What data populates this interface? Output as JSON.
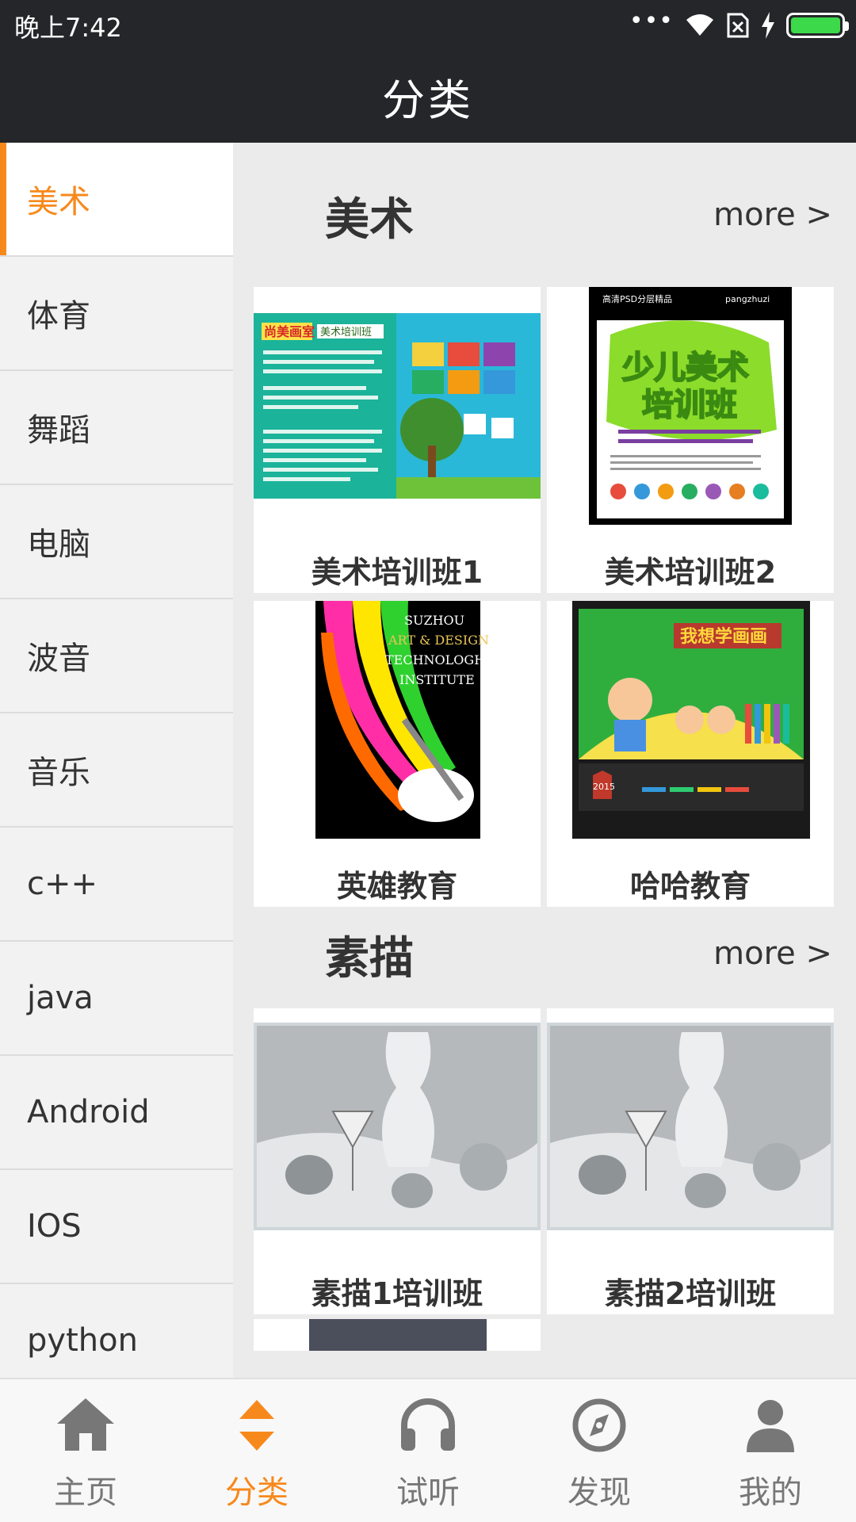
{
  "status_bar": {
    "time": "晚上7:42",
    "dots": "•••"
  },
  "title_bar": {
    "title": "分类"
  },
  "sidebar": {
    "items": [
      {
        "label": "美术"
      },
      {
        "label": "体育"
      },
      {
        "label": "舞蹈"
      },
      {
        "label": "电脑"
      },
      {
        "label": "波音"
      },
      {
        "label": "音乐"
      },
      {
        "label": "c++"
      },
      {
        "label": "java"
      },
      {
        "label": "Android"
      },
      {
        "label": "IOS"
      },
      {
        "label": "python"
      }
    ]
  },
  "sections": [
    {
      "title": "美术",
      "more": "more >",
      "cards": [
        {
          "caption": "美术培训班1"
        },
        {
          "caption": "美术培训班2"
        },
        {
          "caption": "英雄教育"
        },
        {
          "caption": "哈哈教育"
        }
      ]
    },
    {
      "title": "素描",
      "more": "more >",
      "cards": [
        {
          "caption": "素描1培训班"
        },
        {
          "caption": "素描2培训班"
        }
      ]
    }
  ],
  "poster_texts": {
    "p1_badge": "尚美画室",
    "p1_sub": "美术培训班",
    "p2_header_left": "高清PSD分层精品",
    "p2_header_right": "pangzhuzi",
    "p2_title_1": "少儿美术",
    "p2_title_2": "培训班",
    "p3_lines": [
      "SUZHOU",
      "ART & DESIGN",
      "TECHNOLOGHY",
      "INSTITUTE"
    ],
    "p4_title": "我想学画画",
    "p4_badge": "2015"
  },
  "bottom_nav": {
    "items": [
      {
        "label": "主页",
        "icon": "home-icon"
      },
      {
        "label": "分类",
        "icon": "category-icon"
      },
      {
        "label": "试听",
        "icon": "headphones-icon"
      },
      {
        "label": "发现",
        "icon": "compass-icon"
      },
      {
        "label": "我的",
        "icon": "user-icon"
      }
    ]
  },
  "colors": {
    "accent": "#f7891c",
    "bar": "#252629",
    "battery": "#3cd94a"
  }
}
